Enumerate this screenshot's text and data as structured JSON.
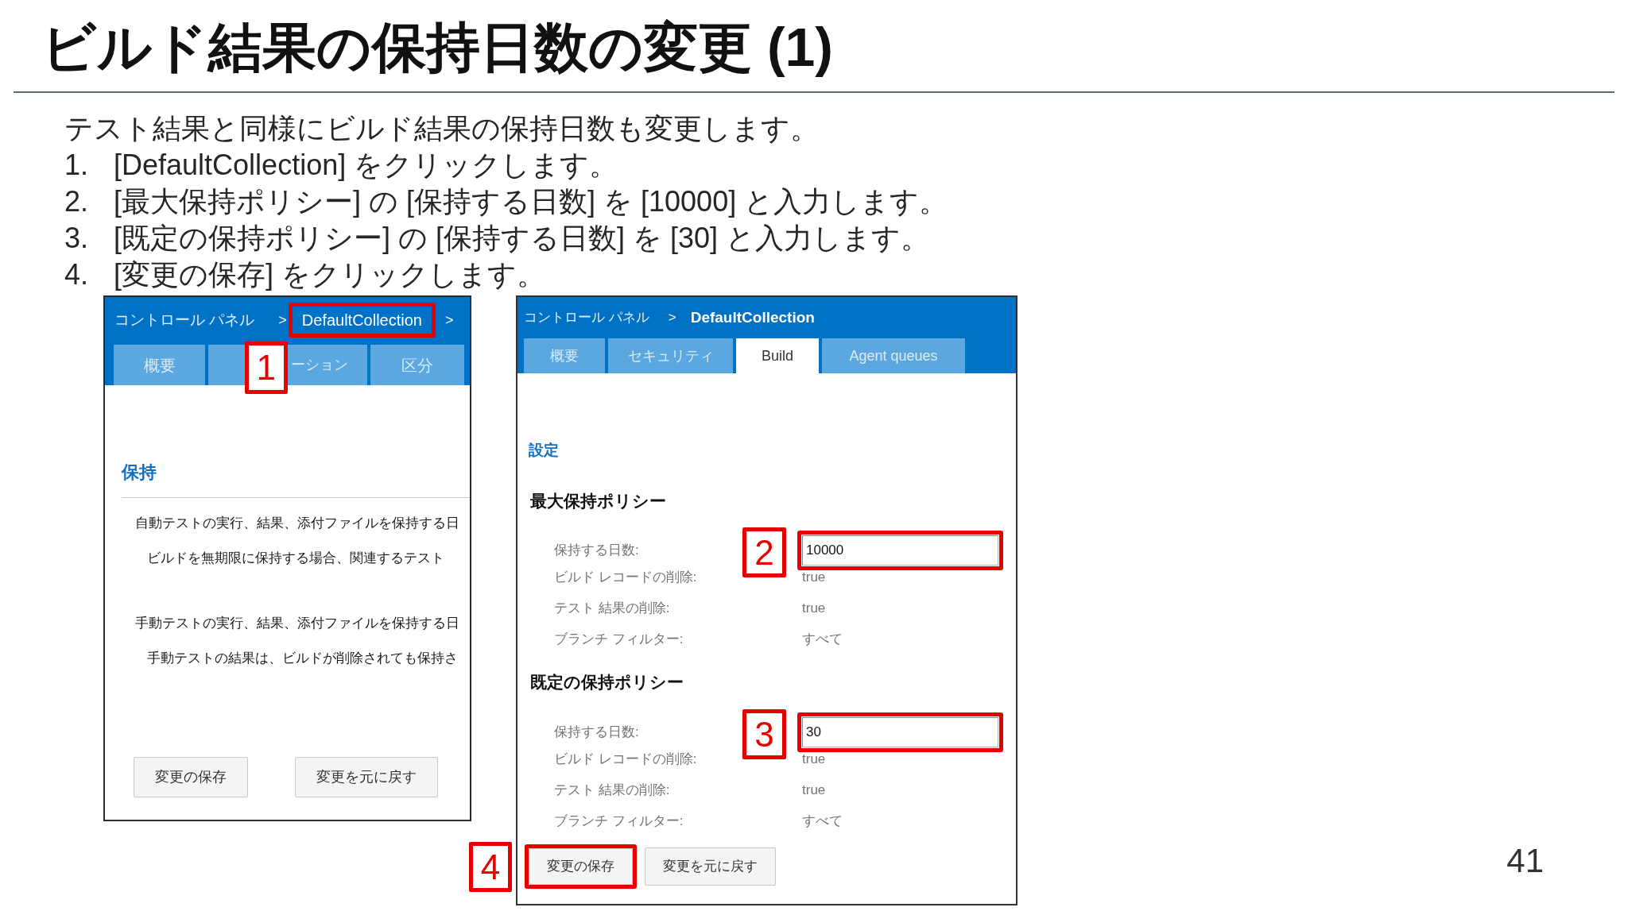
{
  "slide": {
    "title": "ビルド結果の保持日数の変更 (1)",
    "page_number": "41"
  },
  "instructions": {
    "intro": "テスト結果と同様にビルド結果の保持日数も変更します。",
    "steps": [
      {
        "number": "1.",
        "text": "[DefaultCollection] をクリックします。"
      },
      {
        "number": "2.",
        "text": "[最大保持ポリシー] の [保持する日数] を [10000] と入力します。"
      },
      {
        "number": "3.",
        "text": "[既定の保持ポリシー] の [保持する日数] を [30] と入力します。"
      },
      {
        "number": "4.",
        "text": "[変更の保存] をクリックします。"
      }
    ]
  },
  "left_screenshot": {
    "breadcrumb": [
      {
        "kind": "link",
        "text": "コントロール パネル",
        "current": false,
        "highlighted": false
      },
      {
        "kind": "separator",
        "text": ">"
      },
      {
        "kind": "link",
        "text": "DefaultCollection",
        "current": false,
        "highlighted": true,
        "callout": "1"
      },
      {
        "kind": "separator",
        "text": ">"
      }
    ],
    "tabs": [
      {
        "label": "概要",
        "selected": false
      },
      {
        "label": "ーション",
        "selected": false
      },
      {
        "label": "区分",
        "selected": false
      }
    ],
    "section_title": "保持",
    "descriptions": [
      {
        "text": "自動テストの実行、結果、添付ファイルを保持する日",
        "children": [
          {
            "text": "ビルドを無期限に保持する場合、関連するテスト"
          }
        ]
      },
      {
        "text": "手動テストの実行、結果、添付ファイルを保持する日",
        "children": [
          {
            "text": "手動テストの結果は、ビルドが削除されても保持さ"
          }
        ]
      }
    ],
    "buttons": [
      {
        "label": "変更の保存"
      },
      {
        "label": "変更を元に戻す"
      }
    ]
  },
  "right_screenshot": {
    "breadcrumb": [
      {
        "kind": "link",
        "text": "コントロール パネル",
        "current": false,
        "highlighted": false
      },
      {
        "kind": "separator",
        "text": ">"
      },
      {
        "kind": "link",
        "text": "DefaultCollection",
        "current": true,
        "highlighted": false
      }
    ],
    "tabs": [
      {
        "label": "概要",
        "selected": false
      },
      {
        "label": "セキュリティ",
        "selected": false
      },
      {
        "label": "Build",
        "selected": true
      },
      {
        "label": "Agent queues",
        "selected": false
      }
    ],
    "section_title": "設定",
    "policies": [
      {
        "title": "最大保持ポリシー",
        "rows": [
          {
            "kind": "input",
            "label": "保持する日数:",
            "value": "10000",
            "highlighted": true,
            "callout": "2"
          },
          {
            "kind": "text",
            "label": "ビルド レコードの削除:",
            "value": "true"
          },
          {
            "kind": "text",
            "label": "テスト 結果の削除:",
            "value": "true"
          },
          {
            "kind": "text",
            "label": "ブランチ フィルター:",
            "value": "すべて"
          }
        ]
      },
      {
        "title": "既定の保持ポリシー",
        "rows": [
          {
            "kind": "input",
            "label": "保持する日数:",
            "value": "30",
            "highlighted": true,
            "callout": "3"
          },
          {
            "kind": "text",
            "label": "ビルド レコードの削除:",
            "value": "true"
          },
          {
            "kind": "text",
            "label": "テスト 結果の削除:",
            "value": "true"
          },
          {
            "kind": "text",
            "label": "ブランチ フィルター:",
            "value": "すべて"
          }
        ]
      }
    ],
    "buttons": [
      {
        "label": "変更の保存",
        "highlighted": true,
        "callout": "4"
      },
      {
        "label": "変更を元に戻す",
        "highlighted": false
      }
    ]
  }
}
